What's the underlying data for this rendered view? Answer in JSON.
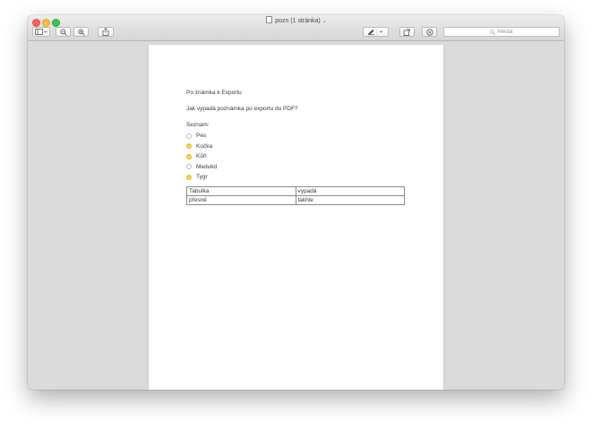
{
  "window": {
    "title": "pozn (1 stránka)",
    "title_chevron": "⌄"
  },
  "toolbar": {
    "search_placeholder": "Hledat"
  },
  "document": {
    "heading": "Po  známka k Exportu",
    "question": "Jak vypadá poznámka po exportu do PDF?",
    "list_label": "Seznam:",
    "list": [
      {
        "label": "Pes",
        "checked": false
      },
      {
        "label": "Kočka",
        "checked": true
      },
      {
        "label": "Kůň",
        "checked": true
      },
      {
        "label": "Medvěd",
        "checked": false
      },
      {
        "label": "Tygr",
        "checked": true
      }
    ],
    "table": [
      [
        "Tabulka",
        "vypadá"
      ],
      [
        "přesně",
        "takhle"
      ]
    ]
  },
  "colors": {
    "checked": "#f2bd2e",
    "close": "#fc605c",
    "minimize": "#fdbc40",
    "maximize": "#34c84a"
  }
}
